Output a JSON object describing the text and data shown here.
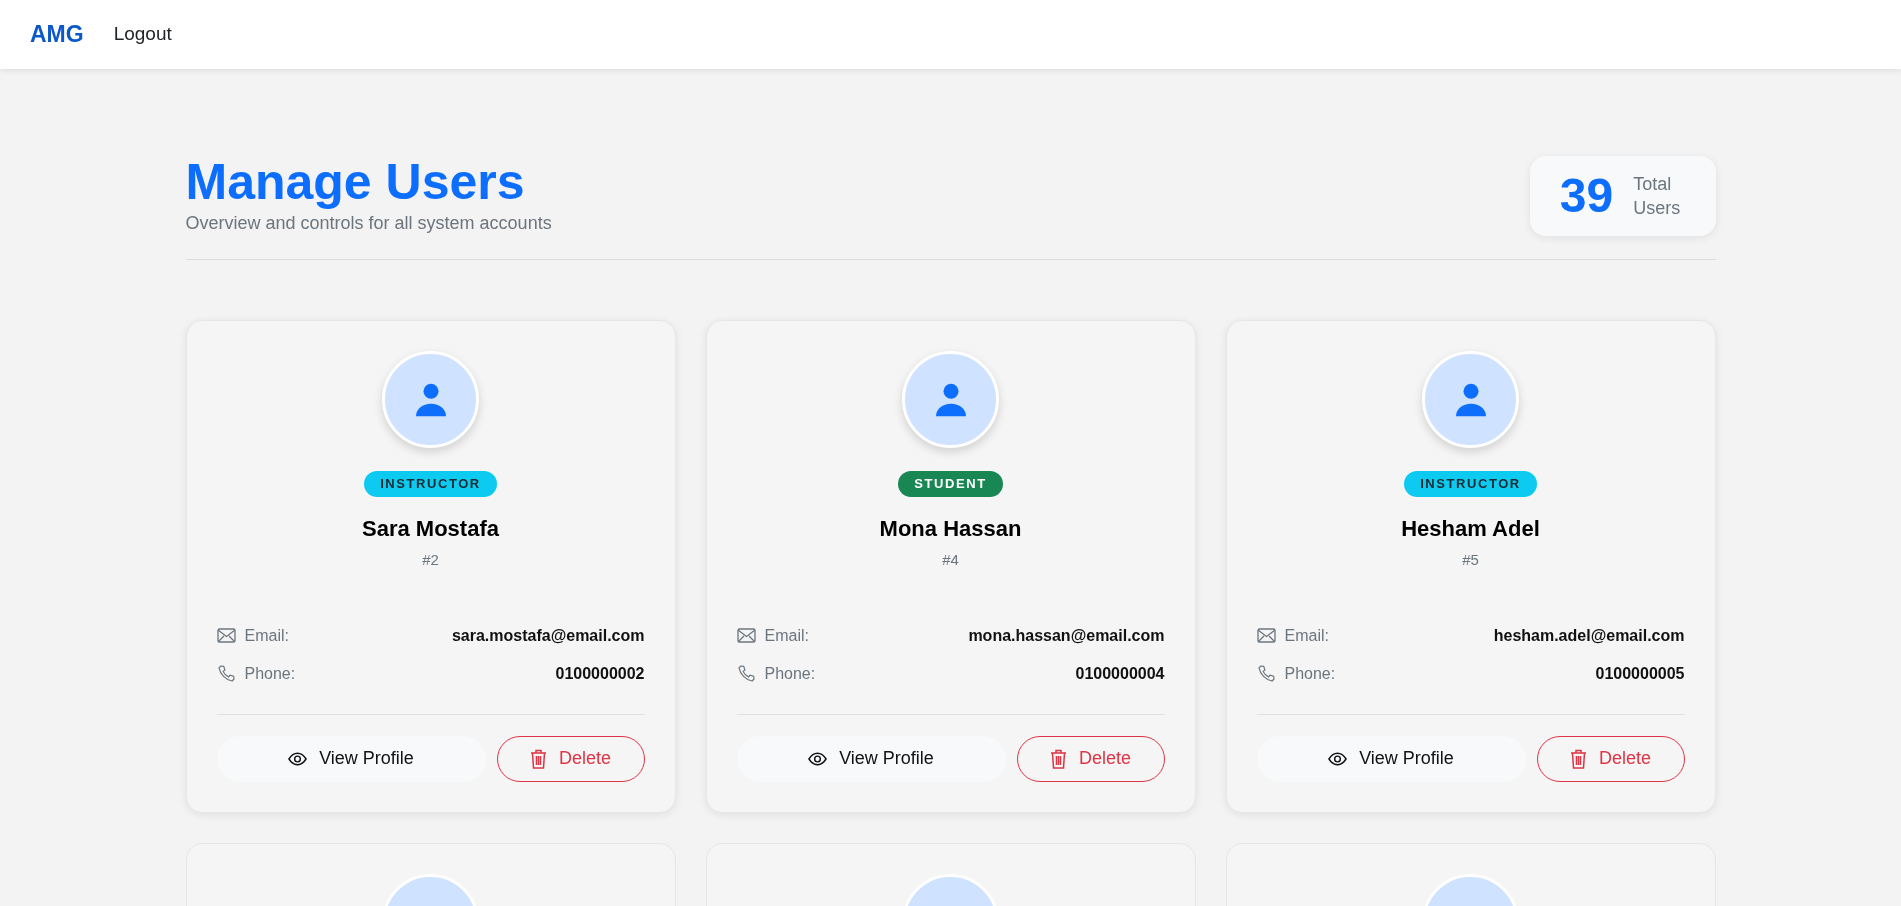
{
  "navbar": {
    "brand": "AMG",
    "links": [
      "Logout"
    ]
  },
  "header": {
    "title": "Manage Users",
    "subtitle": "Overview and controls for all system accounts",
    "total": {
      "count": "39",
      "label": "Total Users"
    }
  },
  "users": [
    {
      "kind": "instructor",
      "role": "INSTRUCTOR",
      "name": "Sara Mostafa",
      "id": "#2",
      "email_label": "Email:",
      "email": "sara.mostafa@email.com",
      "phone_label": "Phone:",
      "phone": "0100000002",
      "view_label": "View Profile",
      "delete_label": "Delete"
    },
    {
      "kind": "student",
      "role": "STUDENT",
      "name": "Mona Hassan",
      "id": "#4",
      "email_label": "Email:",
      "email": "mona.hassan@email.com",
      "phone_label": "Phone:",
      "phone": "0100000004",
      "view_label": "View Profile",
      "delete_label": "Delete"
    },
    {
      "kind": "instructor",
      "role": "INSTRUCTOR",
      "name": "Hesham Adel",
      "id": "#5",
      "email_label": "Email:",
      "email": "hesham.adel@email.com",
      "phone_label": "Phone:",
      "phone": "0100000005",
      "view_label": "View Profile",
      "delete_label": "Delete"
    }
  ]
}
